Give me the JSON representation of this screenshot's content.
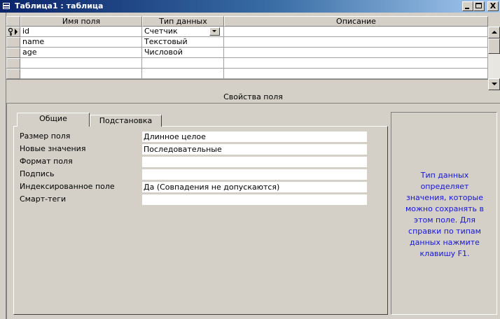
{
  "window": {
    "title": "Таблица1 : таблица",
    "controls": {
      "minimize": "_",
      "maximize": "□",
      "close": "X"
    }
  },
  "grid": {
    "columns": [
      "Имя поля",
      "Тип данных",
      "Описание"
    ],
    "rows": [
      {
        "name": "id",
        "type": "Счетчик",
        "description": "",
        "primary_key": true,
        "current": true
      },
      {
        "name": "name",
        "type": "Текстовый",
        "description": ""
      },
      {
        "name": "age",
        "type": "Числовой",
        "description": ""
      },
      {
        "name": "",
        "type": "",
        "description": ""
      },
      {
        "name": "",
        "type": "",
        "description": ""
      }
    ]
  },
  "properties": {
    "caption": "Свойства поля",
    "tabs": [
      "Общие",
      "Подстановка"
    ],
    "active_tab": "Общие",
    "fields": [
      {
        "label": "Размер поля",
        "value": "Длинное целое"
      },
      {
        "label": "Новые значения",
        "value": "Последовательные"
      },
      {
        "label": "Формат поля",
        "value": ""
      },
      {
        "label": "Подпись",
        "value": ""
      },
      {
        "label": "Индексированное поле",
        "value": "Да (Совпадения не допускаются)"
      },
      {
        "label": "Смарт-теги",
        "value": ""
      }
    ],
    "help_text": "Тип данных определяет значения, которые можно сохранять в этом поле. Для справки по типам данных нажмите клавишу F1.",
    "help_text_lines": "Тип данных\nопределяет\nзначения, которые\nможно сохранять в\nэтом поле. Для\nсправки по типам\nданных нажмите\nклавишу F1."
  },
  "icons": {
    "window_icon": "table-icon",
    "row_selector_icon": "key-icon",
    "current_row_icon": "current-row-pointer-icon"
  },
  "colors": {
    "titlebar_start": "#0a246a",
    "titlebar_end": "#a6caf0",
    "help_text": "#1515d8",
    "face": "#d4d0c8"
  }
}
